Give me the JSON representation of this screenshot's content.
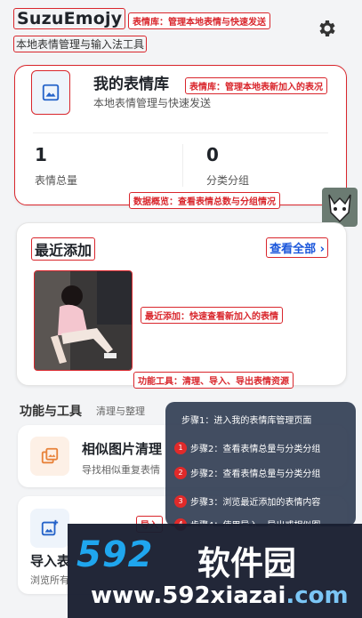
{
  "header": {
    "app_title": "SuzuEmojy",
    "app_subtitle": "本地表情管理与输入法工具",
    "title_callout": "表情库：管理本地表情与快速发送"
  },
  "library": {
    "title": "我的表情库",
    "subtitle": "本地表情管理与快速发送",
    "callout": "表情库：管理本地表新加入的表况",
    "total_count": "1",
    "total_label": "表情总量",
    "group_count": "0",
    "group_label": "分类分组",
    "stats_callout": "数据概览：查看表情总数与分组情况"
  },
  "recent": {
    "title": "最近添加",
    "view_all": "查看全部",
    "callout": "最近添加：快速查看新加入的表情",
    "tools_callout": "功能工具：清理、导入、导出表情资源"
  },
  "tools": {
    "title": "功能与工具",
    "subtitle": "清理与整理",
    "similar_title": "相似图片清理",
    "similar_sub": "导找相似重复表情",
    "import_title": "导入表",
    "import_sub": "浏览所有",
    "import_callout": "导入"
  },
  "steps": {
    "s0": "步骤1：进入我的表情库管理页面",
    "s1_num": "1",
    "s1": "步骤2：查看表情总量与分类分组",
    "s2_num": "2",
    "s2": "步骤2：查看表情总量与分类分组",
    "s3_num": "3",
    "s3": "步骤3：浏览最近添加的表情内容",
    "s4_num": "4",
    "s4": "步骤4：使用导入、导出或相似图"
  },
  "watermark": {
    "logo": "592",
    "brand": "软件园",
    "url_main": "www.592xiazai",
    "url_tld": ".com"
  },
  "colors": {
    "accent": "#1a56db",
    "annotation": "#d9262c",
    "icon_blue": "#2563c9",
    "icon_orange": "#e8823a"
  }
}
